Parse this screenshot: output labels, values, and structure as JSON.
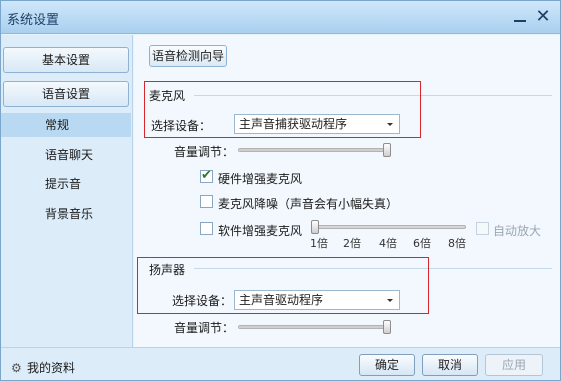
{
  "window": {
    "title": "系统设置"
  },
  "nav": {
    "basic_label": "基本设置",
    "voice_label": "语音设置",
    "items": [
      {
        "label": "常规",
        "active": true
      },
      {
        "label": "语音聊天",
        "active": false
      },
      {
        "label": "提示音",
        "active": false
      },
      {
        "label": "背景音乐",
        "active": false
      }
    ]
  },
  "content": {
    "wizard_label": "语音检测向导",
    "mic": {
      "section_title": "麦克风",
      "device_label": "选择设备：",
      "device_value": "主声音捕获驱动程序",
      "volume_label": "音量调节：",
      "volume_level": 1.0,
      "hardware_boost": {
        "label": "硬件增强麦克风",
        "checked": true
      },
      "noise_reduction": {
        "label": "麦克风降噪（声音会有小幅失真）",
        "checked": false
      },
      "software_boost": {
        "label": "软件增强麦克风",
        "checked": false
      },
      "boost_ticks": [
        "1倍",
        "2倍",
        "4倍",
        "6倍",
        "8倍"
      ],
      "auto_amplify": {
        "label": "自动放大",
        "checked": false,
        "enabled": false
      }
    },
    "speaker": {
      "section_title": "扬声器",
      "device_label": "选择设备：",
      "device_value": "主声音驱动程序",
      "volume_label": "音量调节：",
      "volume_level": 1.0
    }
  },
  "footer": {
    "profile_label": "我的资料",
    "ok_label": "确定",
    "cancel_label": "取消",
    "apply_label": "应用"
  },
  "icons": {
    "profile": "gear-icon",
    "minimize": "minimize-icon",
    "close": "close-icon",
    "checkmark": "checkmark-icon",
    "dropdown": "chevron-down-icon"
  },
  "colors": {
    "title_bar": "#a9d0f0",
    "highlight_box": "#d9262b",
    "nav_active": "#b9d8f2"
  }
}
